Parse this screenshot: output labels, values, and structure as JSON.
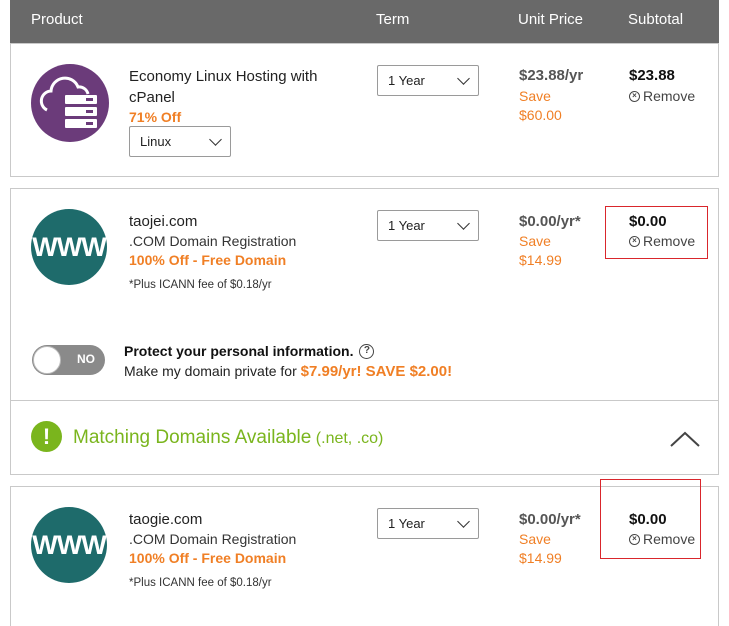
{
  "header": {
    "product": "Product",
    "term": "Term",
    "unit_price": "Unit Price",
    "subtotal": "Subtotal"
  },
  "items": [
    {
      "name_line1": "Economy Linux Hosting with",
      "name_line2": "cPanel",
      "discount": "71% Off",
      "os_select": "Linux",
      "term": "1 Year",
      "unit_price": "$23.88/yr",
      "save_label": "Save",
      "save_amount": "$60.00",
      "subtotal": "$23.88",
      "remove": "Remove"
    },
    {
      "icon_text": "WWW",
      "name": "taojei.com",
      "type": ".COM Domain Registration",
      "discount": "100% Off - Free Domain",
      "fee_note": "*Plus ICANN fee of $0.18/yr",
      "term": "1 Year",
      "unit_price": "$0.00/yr*",
      "save_label": "Save",
      "save_amount": "$14.99",
      "subtotal": "$0.00",
      "remove": "Remove"
    },
    {
      "icon_text": "WWW",
      "name": "taogie.com",
      "type": ".COM Domain Registration",
      "discount": "100% Off - Free Domain",
      "fee_note": "*Plus ICANN fee of $0.18/yr",
      "term": "1 Year",
      "unit_price": "$0.00/yr*",
      "save_label": "Save",
      "save_amount": "$14.99",
      "subtotal": "$0.00",
      "remove": "Remove"
    }
  ],
  "privacy": {
    "toggle_state": "NO",
    "title": "Protect your personal information.",
    "help_icon": "?",
    "desc_prefix": "Make my domain private for ",
    "desc_offer": "$7.99/yr! SAVE $2.00!"
  },
  "matching": {
    "icon": "!",
    "title": "Matching Domains Available",
    "suffix": " (.net, .co)"
  },
  "colors": {
    "accent_orange": "#f07f25",
    "green": "#7ab51d",
    "header_gray": "#696969",
    "teal": "#1e6b6b",
    "purple": "#6b3b7a",
    "highlight_red": "#d9262c"
  }
}
